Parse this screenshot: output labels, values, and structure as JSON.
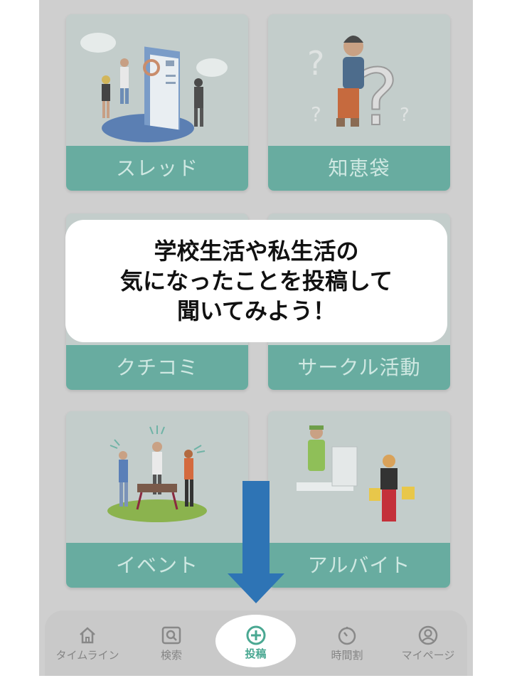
{
  "cards": [
    {
      "label": "スレッド",
      "illustration": "presentation-people-icon"
    },
    {
      "label": "知恵袋",
      "illustration": "thinking-person-question-icon"
    },
    {
      "label": "クチコミ",
      "illustration": "review-icon"
    },
    {
      "label": "サークル活動",
      "illustration": "club-activity-icon"
    },
    {
      "label": "イベント",
      "illustration": "bbq-party-icon"
    },
    {
      "label": "アルバイト",
      "illustration": "part-time-job-icon"
    }
  ],
  "overlay": {
    "lines": [
      "学校生活や私生活の",
      "気になったことを投稿して",
      "聞いてみよう！"
    ]
  },
  "nav": {
    "items": [
      {
        "label": "タイムライン",
        "icon": "home-icon"
      },
      {
        "label": "検索",
        "icon": "search-icon"
      },
      {
        "label": "投稿",
        "icon": "plus-circle-icon",
        "active": true
      },
      {
        "label": "時間割",
        "icon": "timer-icon"
      },
      {
        "label": "マイページ",
        "icon": "user-icon"
      }
    ]
  },
  "colors": {
    "accent": "#4aa892",
    "card_label_bg": "#68aca0",
    "arrow": "#2e74b5",
    "dim_bg": "#cfcfcf"
  }
}
